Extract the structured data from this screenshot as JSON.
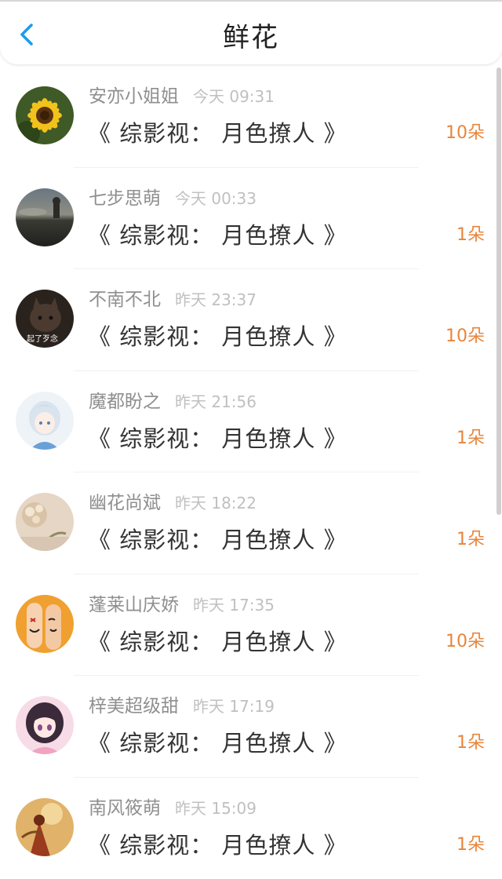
{
  "header": {
    "title": "鲜花",
    "back_icon": "chevron-left-icon",
    "accent_color": "#1a9cf0"
  },
  "items": [
    {
      "nickname": "安亦小姐姐",
      "time": "今天 09:31",
      "book": "《 综影视： 月色撩人 》",
      "count": "10朵"
    },
    {
      "nickname": "七步思萌",
      "time": "今天 00:33",
      "book": "《 综影视： 月色撩人 》",
      "count": "1朵"
    },
    {
      "nickname": "不南不北",
      "time": "昨天 23:37",
      "book": "《 综影视： 月色撩人 》",
      "count": "10朵",
      "avatar_caption": "起了歹念"
    },
    {
      "nickname": "魔都盼之",
      "time": "昨天 21:56",
      "book": "《 综影视： 月色撩人 》",
      "count": "1朵"
    },
    {
      "nickname": "幽花尚斌",
      "time": "昨天 18:22",
      "book": "《 综影视： 月色撩人 》",
      "count": "1朵"
    },
    {
      "nickname": "蓬莱山庆娇",
      "time": "昨天 17:35",
      "book": "《 综影视： 月色撩人 》",
      "count": "10朵"
    },
    {
      "nickname": "梓美超级甜",
      "time": "昨天 17:19",
      "book": "《 综影视： 月色撩人 》",
      "count": "1朵"
    },
    {
      "nickname": "南风筱萌",
      "time": "昨天 15:09",
      "book": "《 综影视： 月色撩人 》",
      "count": "1朵"
    }
  ],
  "colors": {
    "count": "#e8853a",
    "nickname": "#8f8f8f",
    "time": "#c0c0c0",
    "book": "#333333"
  }
}
